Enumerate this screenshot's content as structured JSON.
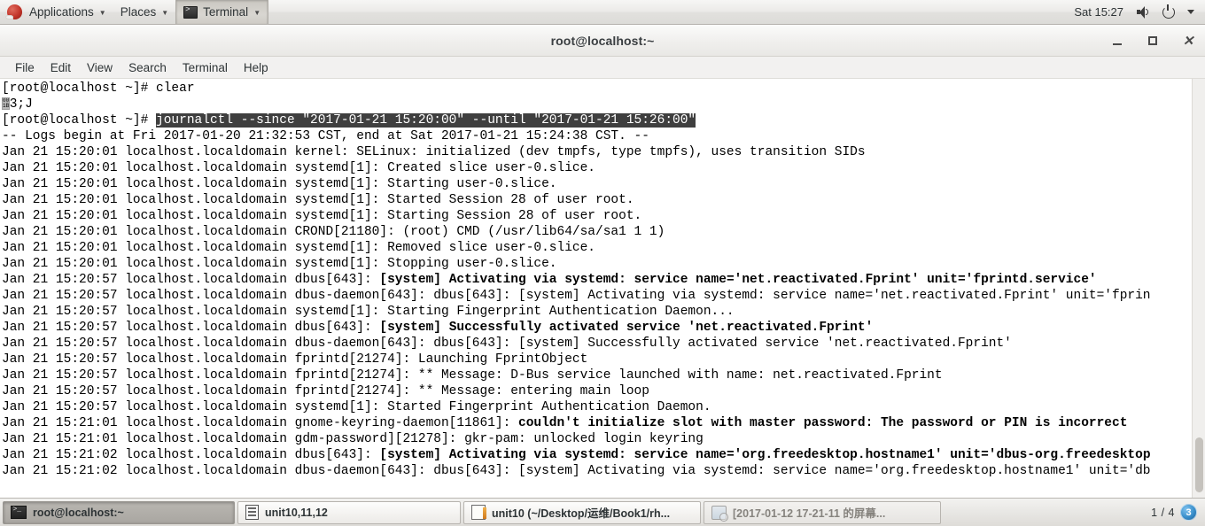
{
  "top_panel": {
    "applications": "Applications",
    "places": "Places",
    "terminal": "Terminal",
    "clock": "Sat 15:27",
    "icons": {
      "redhat": "redhat-logo",
      "volume": "volume-icon",
      "power": "power-icon",
      "caret": "caret-down-icon"
    }
  },
  "window": {
    "title": "root@localhost:~",
    "buttons": {
      "minimize": "–",
      "maximize": "□",
      "close": "✕"
    },
    "menu": [
      "File",
      "Edit",
      "View",
      "Search",
      "Terminal",
      "Help"
    ]
  },
  "terminal": {
    "prompt": "[root@localhost ~]# ",
    "command_1": "clear",
    "escape_line": "3;J",
    "escape_glyph_top": "00",
    "escape_glyph_bottom": "1B",
    "command_2_selected": "journalctl --since \"2017-01-21 15:20:00\" --until \"2017-01-21 15:26:00\"",
    "lines": [
      {
        "text": "-- Logs begin at Fri 2017-01-20 21:32:53 CST, end at Sat 2017-01-21 15:24:38 CST. --",
        "bold_from": null
      },
      {
        "text": "Jan 21 15:20:01 localhost.localdomain kernel: SELinux: initialized (dev tmpfs, type tmpfs), uses transition SIDs",
        "bold_from": null
      },
      {
        "text": "Jan 21 15:20:01 localhost.localdomain systemd[1]: Created slice user-0.slice.",
        "bold_from": null
      },
      {
        "text": "Jan 21 15:20:01 localhost.localdomain systemd[1]: Starting user-0.slice.",
        "bold_from": null
      },
      {
        "text": "Jan 21 15:20:01 localhost.localdomain systemd[1]: Started Session 28 of user root.",
        "bold_from": null
      },
      {
        "text": "Jan 21 15:20:01 localhost.localdomain systemd[1]: Starting Session 28 of user root.",
        "bold_from": null
      },
      {
        "text": "Jan 21 15:20:01 localhost.localdomain CROND[21180]: (root) CMD (/usr/lib64/sa/sa1 1 1)",
        "bold_from": null
      },
      {
        "text": "Jan 21 15:20:01 localhost.localdomain systemd[1]: Removed slice user-0.slice.",
        "bold_from": null
      },
      {
        "text": "Jan 21 15:20:01 localhost.localdomain systemd[1]: Stopping user-0.slice.",
        "bold_from": null
      },
      {
        "text": "Jan 21 15:20:57 localhost.localdomain dbus[643]: ",
        "bold": "[system] Activating via systemd: service name='net.reactivated.Fprint' unit='fprintd.service'"
      },
      {
        "text": "Jan 21 15:20:57 localhost.localdomain dbus-daemon[643]: dbus[643]: [system] Activating via systemd: service name='net.reactivated.Fprint' unit='fprin",
        "bold_from": null
      },
      {
        "text": "Jan 21 15:20:57 localhost.localdomain systemd[1]: Starting Fingerprint Authentication Daemon...",
        "bold_from": null
      },
      {
        "text": "Jan 21 15:20:57 localhost.localdomain dbus[643]: ",
        "bold": "[system] Successfully activated service 'net.reactivated.Fprint'"
      },
      {
        "text": "Jan 21 15:20:57 localhost.localdomain dbus-daemon[643]: dbus[643]: [system] Successfully activated service 'net.reactivated.Fprint'",
        "bold_from": null
      },
      {
        "text": "Jan 21 15:20:57 localhost.localdomain fprintd[21274]: Launching FprintObject",
        "bold_from": null
      },
      {
        "text": "Jan 21 15:20:57 localhost.localdomain fprintd[21274]: ** Message: D-Bus service launched with name: net.reactivated.Fprint",
        "bold_from": null
      },
      {
        "text": "Jan 21 15:20:57 localhost.localdomain fprintd[21274]: ** Message: entering main loop",
        "bold_from": null
      },
      {
        "text": "Jan 21 15:20:57 localhost.localdomain systemd[1]: Started Fingerprint Authentication Daemon.",
        "bold_from": null
      },
      {
        "text": "Jan 21 15:21:01 localhost.localdomain gnome-keyring-daemon[11861]: ",
        "bold": "couldn't initialize slot with master password: The password or PIN is incorrect"
      },
      {
        "text": "Jan 21 15:21:01 localhost.localdomain gdm-password][21278]: gkr-pam: unlocked login keyring",
        "bold_from": null
      },
      {
        "text": "Jan 21 15:21:02 localhost.localdomain dbus[643]: ",
        "bold": "[system] Activating via systemd: service name='org.freedesktop.hostname1' unit='dbus-org.freedesktop"
      },
      {
        "text": "Jan 21 15:21:02 localhost.localdomain dbus-daemon[643]: dbus[643]: [system] Activating via systemd: service name='org.freedesktop.hostname1' unit='db",
        "bold_from": null
      }
    ]
  },
  "taskbar": {
    "tasks": [
      {
        "label": "root@localhost:~",
        "icon": "terminal-icon",
        "state": "active"
      },
      {
        "label": "unit10,11,12",
        "icon": "document-icon",
        "state": "normal"
      },
      {
        "label": "unit10 (~/Desktop/运维/Book1/rh...",
        "icon": "editor-icon",
        "state": "normal"
      },
      {
        "label": "[2017-01-12 17-21-11 的屏幕...",
        "icon": "image-viewer-icon",
        "state": "dim"
      }
    ],
    "workspace": {
      "count_label": "1 / 4",
      "badge": "3"
    }
  },
  "colors": {
    "terminal_bg": "#ffffff",
    "terminal_fg": "#000000",
    "selection_bg": "#3f3f3f",
    "selection_fg": "#ffffff",
    "panel_bg": "#e8e7e4"
  }
}
